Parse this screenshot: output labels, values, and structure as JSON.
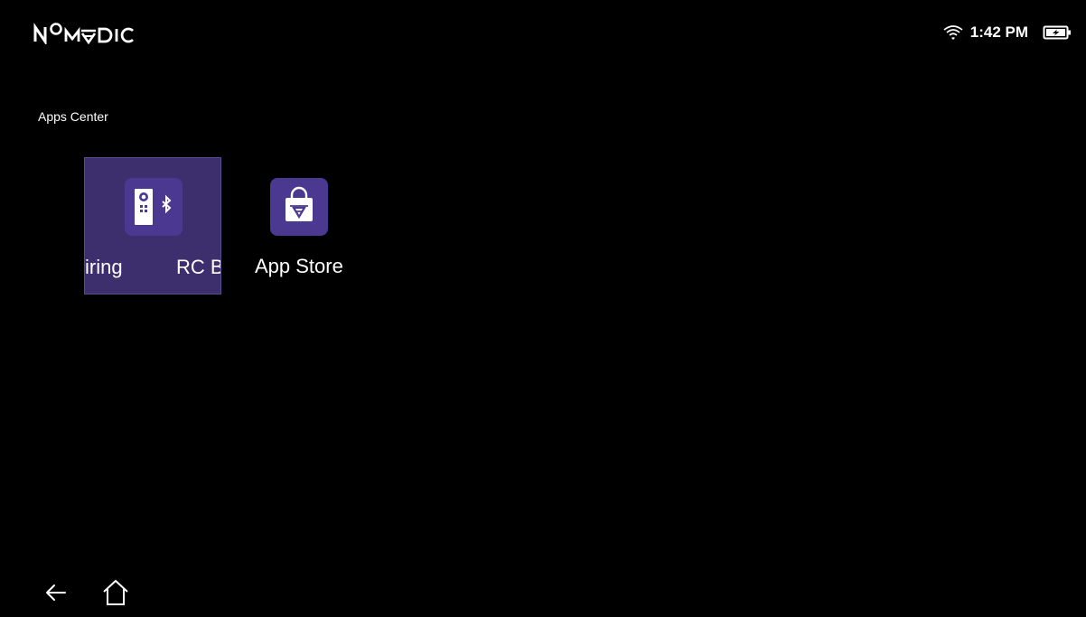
{
  "status_bar": {
    "brand": "NOMVDIC",
    "time": "1:42 PM",
    "wifi_icon": "wifi-icon",
    "battery_icon": "battery-charging-icon"
  },
  "section": {
    "title": "Apps Center"
  },
  "apps": [
    {
      "label_visible": "iring      RC B",
      "label_part1": "iring",
      "label_part2": "RC B",
      "icon": "remote-bluetooth-icon",
      "focused": true
    },
    {
      "label": "App Store",
      "icon": "app-store-bag-icon",
      "focused": false
    }
  ],
  "nav": {
    "back_icon": "back-arrow-icon",
    "home_icon": "home-icon"
  },
  "colors": {
    "background": "#000000",
    "focus_tile": "#3d2f6e",
    "icon_bg": "#4b3890",
    "text": "#ffffff"
  }
}
